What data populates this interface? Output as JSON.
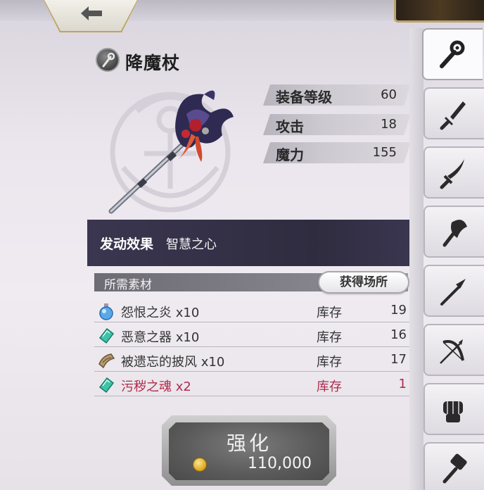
{
  "weapon": {
    "name": "降魔杖",
    "icon": "staff-type-icon"
  },
  "stats": [
    {
      "label": "装备等级",
      "value": "60"
    },
    {
      "label": "攻击",
      "value": "18"
    },
    {
      "label": "魔力",
      "value": "155"
    }
  ],
  "effect": {
    "label": "发动效果",
    "value": "智慧之心"
  },
  "materials": {
    "header": "所需素材",
    "source_button": "获得场所",
    "stock_label": "库存",
    "items": [
      {
        "name": "怨恨之炎 x10",
        "stock": "19",
        "icon": "blue-potion-icon",
        "sufficient": true
      },
      {
        "name": "恶意之器 x10",
        "stock": "16",
        "icon": "green-crystal-icon",
        "sufficient": true
      },
      {
        "name": "被遗忘的披风 x10",
        "stock": "17",
        "icon": "cloth-scroll-icon",
        "sufficient": true
      },
      {
        "name": "污秽之魂 x2",
        "stock": "1",
        "icon": "green-crystal-icon",
        "sufficient": false
      }
    ]
  },
  "enhance": {
    "label": "强化",
    "cost": "110,000",
    "currency_icon": "gil-coin-icon"
  },
  "tabs": [
    {
      "icon": "staff-icon",
      "active": true
    },
    {
      "icon": "sword-icon",
      "active": false
    },
    {
      "icon": "katana-icon",
      "active": false
    },
    {
      "icon": "axe-icon",
      "active": false
    },
    {
      "icon": "spear-icon",
      "active": false
    },
    {
      "icon": "bow-icon",
      "active": false
    },
    {
      "icon": "gauntlet-icon",
      "active": false
    },
    {
      "icon": "hammer-icon",
      "active": false
    }
  ],
  "colors": {
    "effect_bar": "#342f46",
    "insufficient": "#b02a4a",
    "header_bar": "#7a7880"
  }
}
